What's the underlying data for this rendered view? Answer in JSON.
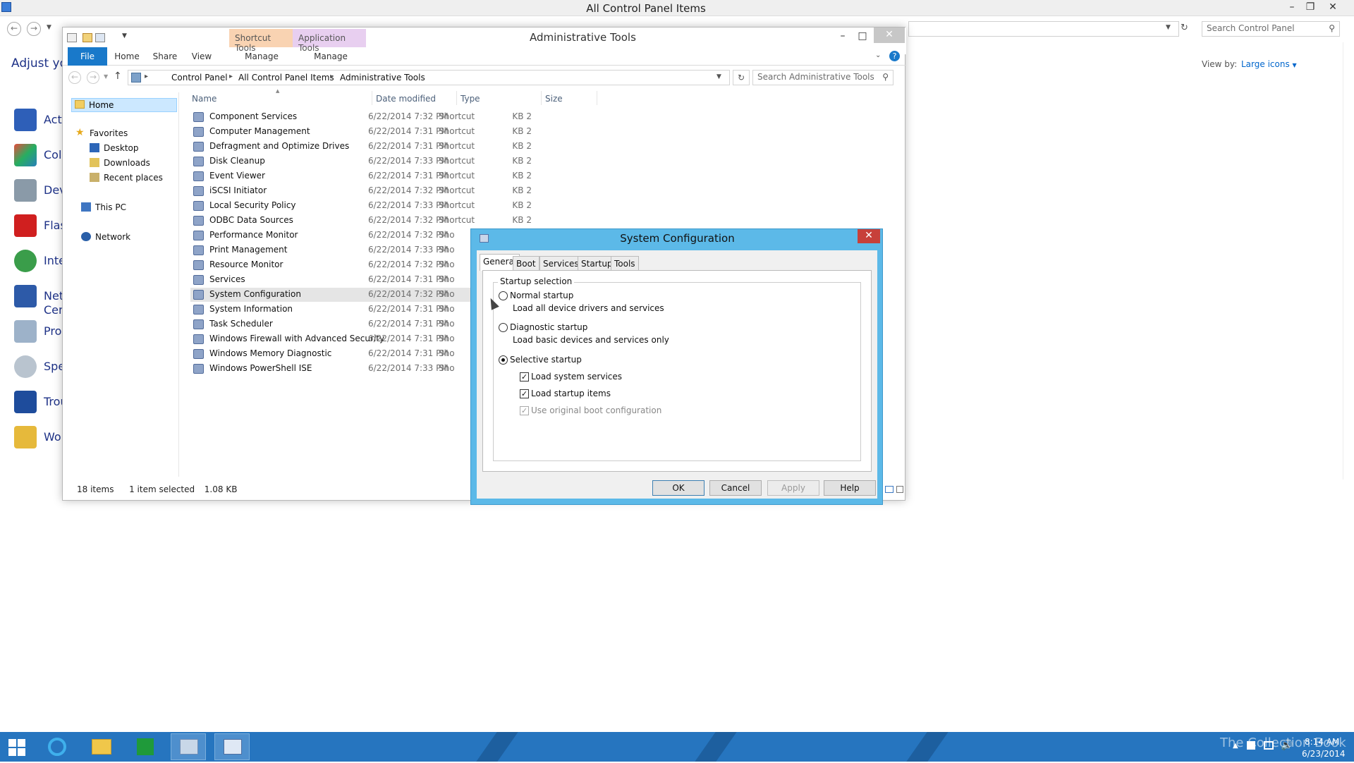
{
  "control_panel": {
    "title": "All Control Panel Items",
    "search_placeholder": "Search Control Panel",
    "heading_partial": "Adjust you",
    "view_by_label": "View by:",
    "view_by_value": "Large icons",
    "items": [
      {
        "label": "Acti",
        "icon": "flag-icon"
      },
      {
        "label": "Colo",
        "icon": "color-icon"
      },
      {
        "label": "Dev",
        "icon": "printer-icon"
      },
      {
        "label": "Flas",
        "icon": "flash-icon"
      },
      {
        "label": "Inte",
        "icon": "globe-icon"
      },
      {
        "label": "Net Cen",
        "icon": "network-icon"
      },
      {
        "label": "Pro",
        "icon": "programs-icon"
      },
      {
        "label": "Spe",
        "icon": "microphone-icon"
      },
      {
        "label": "Trou",
        "icon": "troubleshoot-icon"
      },
      {
        "label": "Wo",
        "icon": "folder-icon"
      }
    ]
  },
  "explorer": {
    "title": "Administrative Tools",
    "context_groups": {
      "shortcut": "Shortcut Tools",
      "application": "Application Tools"
    },
    "ribbon_tabs": [
      "File",
      "Home",
      "Share",
      "View",
      "Manage",
      "Manage"
    ],
    "breadcrumb": [
      "Control Panel",
      "All Control Panel Items",
      "Administrative Tools"
    ],
    "search_placeholder": "Search Administrative Tools",
    "nav": {
      "home": "Home",
      "favorites": "Favorites",
      "desktop": "Desktop",
      "downloads": "Downloads",
      "recent": "Recent places",
      "this_pc": "This PC",
      "network": "Network"
    },
    "columns": {
      "name": "Name",
      "date": "Date modified",
      "type": "Type",
      "size": "Size"
    },
    "files": [
      {
        "name": "Component Services",
        "date": "6/22/2014 7:32 PM",
        "type": "Shortcut",
        "size": "2 KB"
      },
      {
        "name": "Computer Management",
        "date": "6/22/2014 7:31 PM",
        "type": "Shortcut",
        "size": "2 KB"
      },
      {
        "name": "Defragment and Optimize Drives",
        "date": "6/22/2014 7:31 PM",
        "type": "Shortcut",
        "size": "2 KB"
      },
      {
        "name": "Disk Cleanup",
        "date": "6/22/2014 7:33 PM",
        "type": "Shortcut",
        "size": "2 KB"
      },
      {
        "name": "Event Viewer",
        "date": "6/22/2014 7:31 PM",
        "type": "Shortcut",
        "size": "2 KB"
      },
      {
        "name": "iSCSI Initiator",
        "date": "6/22/2014 7:32 PM",
        "type": "Shortcut",
        "size": "2 KB"
      },
      {
        "name": "Local Security Policy",
        "date": "6/22/2014 7:33 PM",
        "type": "Shortcut",
        "size": "2 KB"
      },
      {
        "name": "ODBC Data Sources",
        "date": "6/22/2014 7:32 PM",
        "type": "Shortcut",
        "size": "2 KB"
      },
      {
        "name": "Performance Monitor",
        "date": "6/22/2014 7:32 PM",
        "type": "Sho",
        "size": ""
      },
      {
        "name": "Print Management",
        "date": "6/22/2014 7:33 PM",
        "type": "Sho",
        "size": ""
      },
      {
        "name": "Resource Monitor",
        "date": "6/22/2014 7:32 PM",
        "type": "Sho",
        "size": ""
      },
      {
        "name": "Services",
        "date": "6/22/2014 7:31 PM",
        "type": "Sho",
        "size": ""
      },
      {
        "name": "System Configuration",
        "date": "6/22/2014 7:32 PM",
        "type": "Sho",
        "size": ""
      },
      {
        "name": "System Information",
        "date": "6/22/2014 7:31 PM",
        "type": "Sho",
        "size": ""
      },
      {
        "name": "Task Scheduler",
        "date": "6/22/2014 7:31 PM",
        "type": "Sho",
        "size": ""
      },
      {
        "name": "Windows Firewall with Advanced Security",
        "date": "6/22/2014 7:31 PM",
        "type": "Sho",
        "size": ""
      },
      {
        "name": "Windows Memory Diagnostic",
        "date": "6/22/2014 7:31 PM",
        "type": "Sho",
        "size": ""
      },
      {
        "name": "Windows PowerShell ISE",
        "date": "6/22/2014 7:33 PM",
        "type": "Sho",
        "size": ""
      }
    ],
    "selected_file": "System Configuration",
    "status": {
      "count": "18 items",
      "selection": "1 item selected",
      "size": "1.08 KB"
    }
  },
  "dialog": {
    "title": "System Configuration",
    "tabs": [
      "General",
      "Boot",
      "Services",
      "Startup",
      "Tools"
    ],
    "active_tab": "General",
    "group_label": "Startup selection",
    "normal": {
      "label": "Normal startup",
      "desc": "Load all device drivers and services",
      "selected": false
    },
    "diagnostic": {
      "label": "Diagnostic startup",
      "desc": "Load basic devices and services only",
      "selected": false
    },
    "selective": {
      "label": "Selective startup",
      "selected": true
    },
    "load_system_services": {
      "label": "Load system services",
      "checked": true
    },
    "load_startup_items": {
      "label": "Load startup items",
      "checked": true
    },
    "use_original_boot": {
      "label": "Use original boot configuration",
      "checked": true,
      "disabled": true
    },
    "buttons": {
      "ok": "OK",
      "cancel": "Cancel",
      "apply": "Apply",
      "help": "Help"
    }
  },
  "taskbar": {
    "time": "8:14 AM",
    "date": "6/23/2014",
    "watermark": "The Collection Book",
    "apps": [
      "start-icon",
      "internet-explorer-icon",
      "file-explorer-icon",
      "store-icon",
      "control-panel-icon",
      "system-configuration-icon"
    ]
  },
  "colors": {
    "accent": "#1979ca",
    "taskbar": "#2675bf",
    "dialog_frame": "#5cb9e8",
    "close": "#c7403a"
  }
}
